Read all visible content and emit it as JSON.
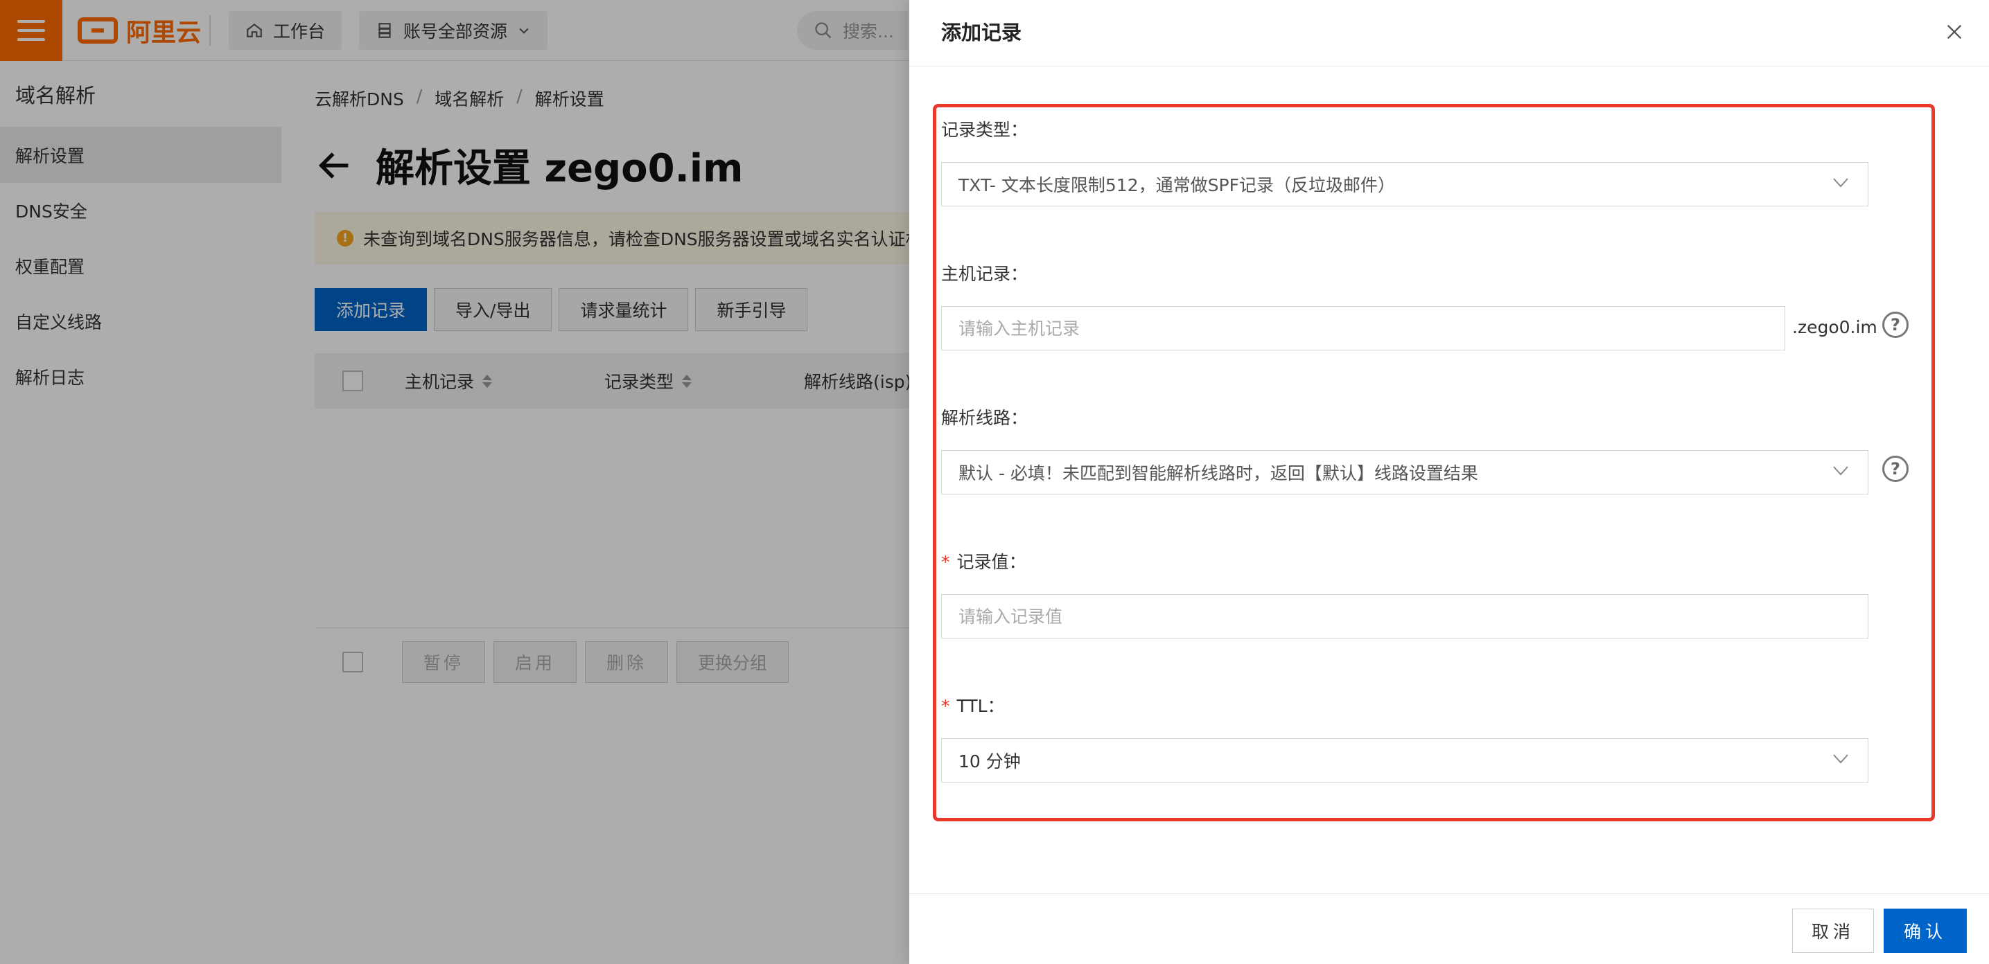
{
  "topbar": {
    "logo_text": "阿里云",
    "workbench_label": "工作台",
    "resources_label": "账号全部资源",
    "search_placeholder": "搜索..."
  },
  "sidebar": {
    "title": "域名解析",
    "items": [
      {
        "label": "解析设置",
        "active": true
      },
      {
        "label": "DNS安全",
        "active": false
      },
      {
        "label": "权重配置",
        "active": false
      },
      {
        "label": "自定义线路",
        "active": false
      },
      {
        "label": "解析日志",
        "active": false
      }
    ]
  },
  "breadcrumb": [
    "云解析DNS",
    "域名解析",
    "解析设置"
  ],
  "page": {
    "title": "解析设置 zego0.im",
    "notice": "未查询到域名DNS服务器信息，请检查DNS服务器设置或域名实名认证相关"
  },
  "actions": {
    "add_record": "添加记录",
    "import_export": "导入/导出",
    "request_stats": "请求量统计",
    "guide": "新手引导"
  },
  "table": {
    "columns": [
      "主机记录",
      "记录类型",
      "解析线路(isp)"
    ]
  },
  "bulk_actions": [
    "暂停",
    "启用",
    "删除",
    "更换分组"
  ],
  "drawer": {
    "title": "添加记录",
    "fields": {
      "record_type": {
        "label": "记录类型：",
        "value": "TXT- 文本长度限制512，通常做SPF记录（反垃圾邮件）"
      },
      "host": {
        "label": "主机记录：",
        "placeholder": "请输入主机记录",
        "suffix": ".zego0.im"
      },
      "line": {
        "label": "解析线路：",
        "value": "默认 - 必填！未匹配到智能解析线路时，返回【默认】线路设置结果"
      },
      "value": {
        "label": "记录值：",
        "placeholder": "请输入记录值"
      },
      "ttl": {
        "label": "TTL：",
        "value": "10 分钟"
      }
    },
    "cancel_label": "取消",
    "confirm_label": "确认"
  },
  "colors": {
    "brand": "#ff6a00",
    "primary": "#0064c8",
    "highlight": "#e8392b",
    "required": "#e8392b"
  }
}
